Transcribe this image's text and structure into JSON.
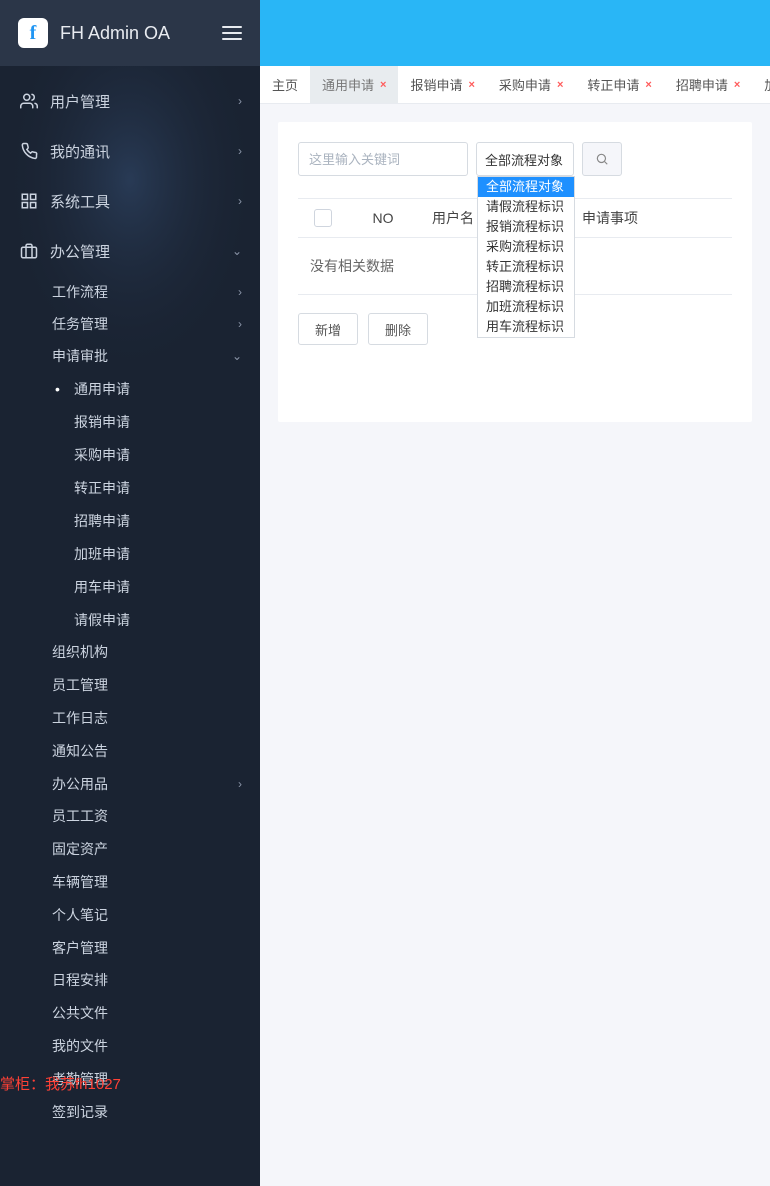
{
  "app_title": "FH Admin OA",
  "sidebar": {
    "sections": [
      {
        "icon": "users",
        "label": "用户管理",
        "chevron": "right"
      },
      {
        "icon": "phone",
        "label": "我的通讯",
        "chevron": "right"
      },
      {
        "icon": "grid",
        "label": "系统工具",
        "chevron": "right"
      },
      {
        "icon": "briefcase",
        "label": "办公管理",
        "chevron": "down"
      }
    ],
    "office_sub": [
      {
        "label": "工作流程",
        "chevron": "right"
      },
      {
        "label": "任务管理",
        "chevron": "right"
      },
      {
        "label": "申请审批",
        "chevron": "down"
      }
    ],
    "apply_sub": [
      {
        "label": "通用申请",
        "active": true
      },
      {
        "label": "报销申请"
      },
      {
        "label": "采购申请"
      },
      {
        "label": "转正申请"
      },
      {
        "label": "招聘申请"
      },
      {
        "label": "加班申请"
      },
      {
        "label": "用车申请"
      },
      {
        "label": "请假申请"
      }
    ],
    "office_rest": [
      {
        "label": "组织机构"
      },
      {
        "label": "员工管理"
      },
      {
        "label": "工作日志"
      },
      {
        "label": "通知公告"
      },
      {
        "label": "办公用品",
        "chevron": "right"
      },
      {
        "label": "员工工资"
      },
      {
        "label": "固定资产"
      },
      {
        "label": "车辆管理"
      },
      {
        "label": "个人笔记"
      },
      {
        "label": "客户管理"
      },
      {
        "label": "日程安排"
      },
      {
        "label": "公共文件"
      },
      {
        "label": "我的文件"
      },
      {
        "label": "考勤管理"
      },
      {
        "label": "签到记录"
      }
    ]
  },
  "tabs": [
    {
      "label": "主页",
      "closable": false
    },
    {
      "label": "通用申请",
      "closable": true,
      "active": true
    },
    {
      "label": "报销申请",
      "closable": true
    },
    {
      "label": "采购申请",
      "closable": true
    },
    {
      "label": "转正申请",
      "closable": true
    },
    {
      "label": "招聘申请",
      "closable": true
    },
    {
      "label": "加班",
      "closable": false
    }
  ],
  "search": {
    "placeholder": "这里输入关键词",
    "select_value": "全部流程对象",
    "options": [
      "全部流程对象",
      "请假流程标识",
      "报销流程标识",
      "采购流程标识",
      "转正流程标识",
      "招聘流程标识",
      "加班流程标识",
      "用车流程标识"
    ]
  },
  "table": {
    "headers": {
      "no": "NO",
      "user": "用户名",
      "matter": "申请事项"
    },
    "empty": "没有相关数据"
  },
  "buttons": {
    "add": "新增",
    "delete": "删除"
  },
  "watermark": "掌柜：我苏fh1027"
}
